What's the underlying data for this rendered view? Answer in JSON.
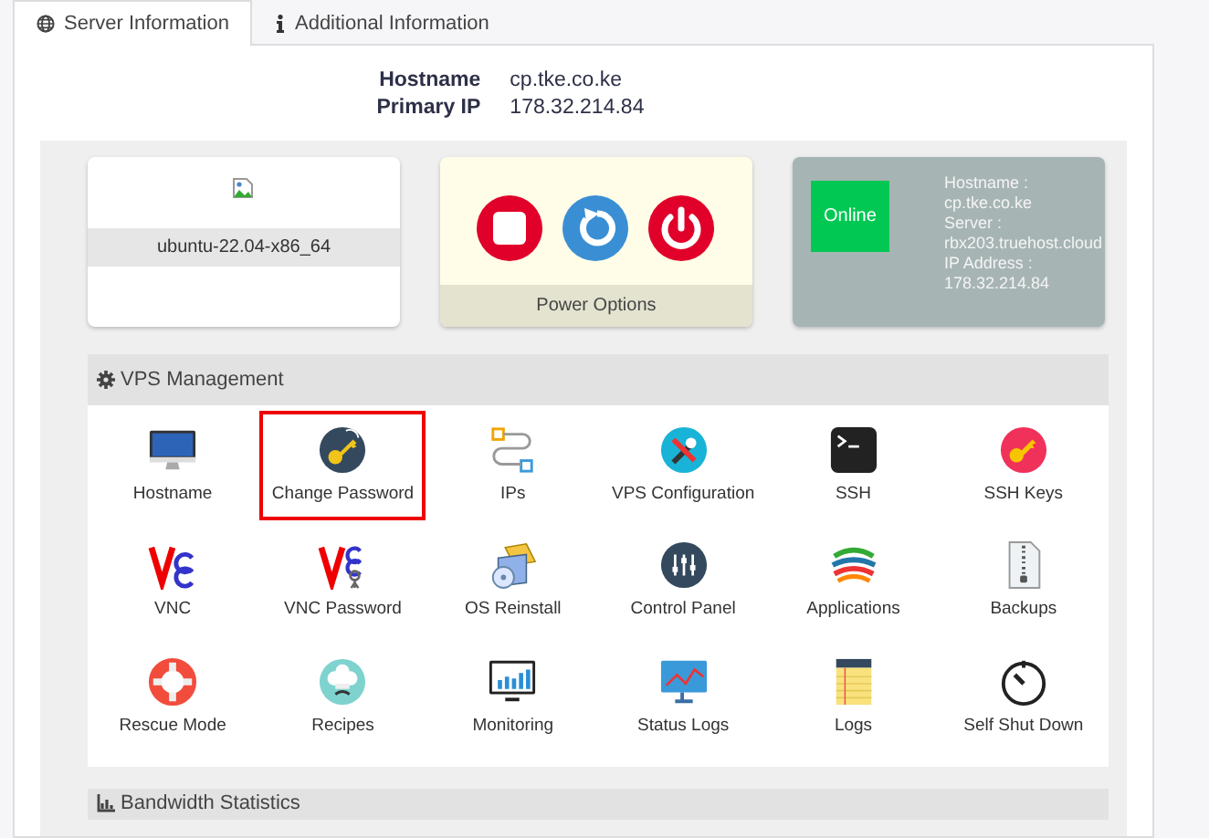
{
  "tabs": [
    {
      "label": "Server Information",
      "selected": true
    },
    {
      "label": "Additional Information",
      "selected": false
    }
  ],
  "server_info": [
    {
      "label": "Hostname",
      "value": "cp.tke.co.ke"
    },
    {
      "label": "Primary IP",
      "value": "178.32.214.84"
    }
  ],
  "os_card": {
    "name": "ubuntu-22.04-x86_64"
  },
  "power_card": {
    "title": "Power Options"
  },
  "status_card": {
    "status": "Online",
    "details": [
      "Hostname :",
      "cp.tke.co.ke",
      "Server :",
      "rbx203.truehost.cloud",
      "IP Address :",
      "178.32.214.84"
    ]
  },
  "vps_management": {
    "title": "VPS Management",
    "items": [
      {
        "label": "Hostname",
        "highlighted": false
      },
      {
        "label": "Change Password",
        "highlighted": true
      },
      {
        "label": "IPs",
        "highlighted": false
      },
      {
        "label": "VPS Configuration",
        "highlighted": false
      },
      {
        "label": "SSH",
        "highlighted": false
      },
      {
        "label": "SSH Keys",
        "highlighted": false
      },
      {
        "label": "VNC",
        "highlighted": false
      },
      {
        "label": "VNC Password",
        "highlighted": false
      },
      {
        "label": "OS Reinstall",
        "highlighted": false
      },
      {
        "label": "Control Panel",
        "highlighted": false
      },
      {
        "label": "Applications",
        "highlighted": false
      },
      {
        "label": "Backups",
        "highlighted": false
      },
      {
        "label": "Rescue Mode",
        "highlighted": false
      },
      {
        "label": "Recipes",
        "highlighted": false
      },
      {
        "label": "Monitoring",
        "highlighted": false
      },
      {
        "label": "Status Logs",
        "highlighted": false
      },
      {
        "label": "Logs",
        "highlighted": false
      },
      {
        "label": "Self Shut Down",
        "highlighted": false
      }
    ]
  },
  "bandwidth": {
    "title": "Bandwidth Statistics"
  }
}
